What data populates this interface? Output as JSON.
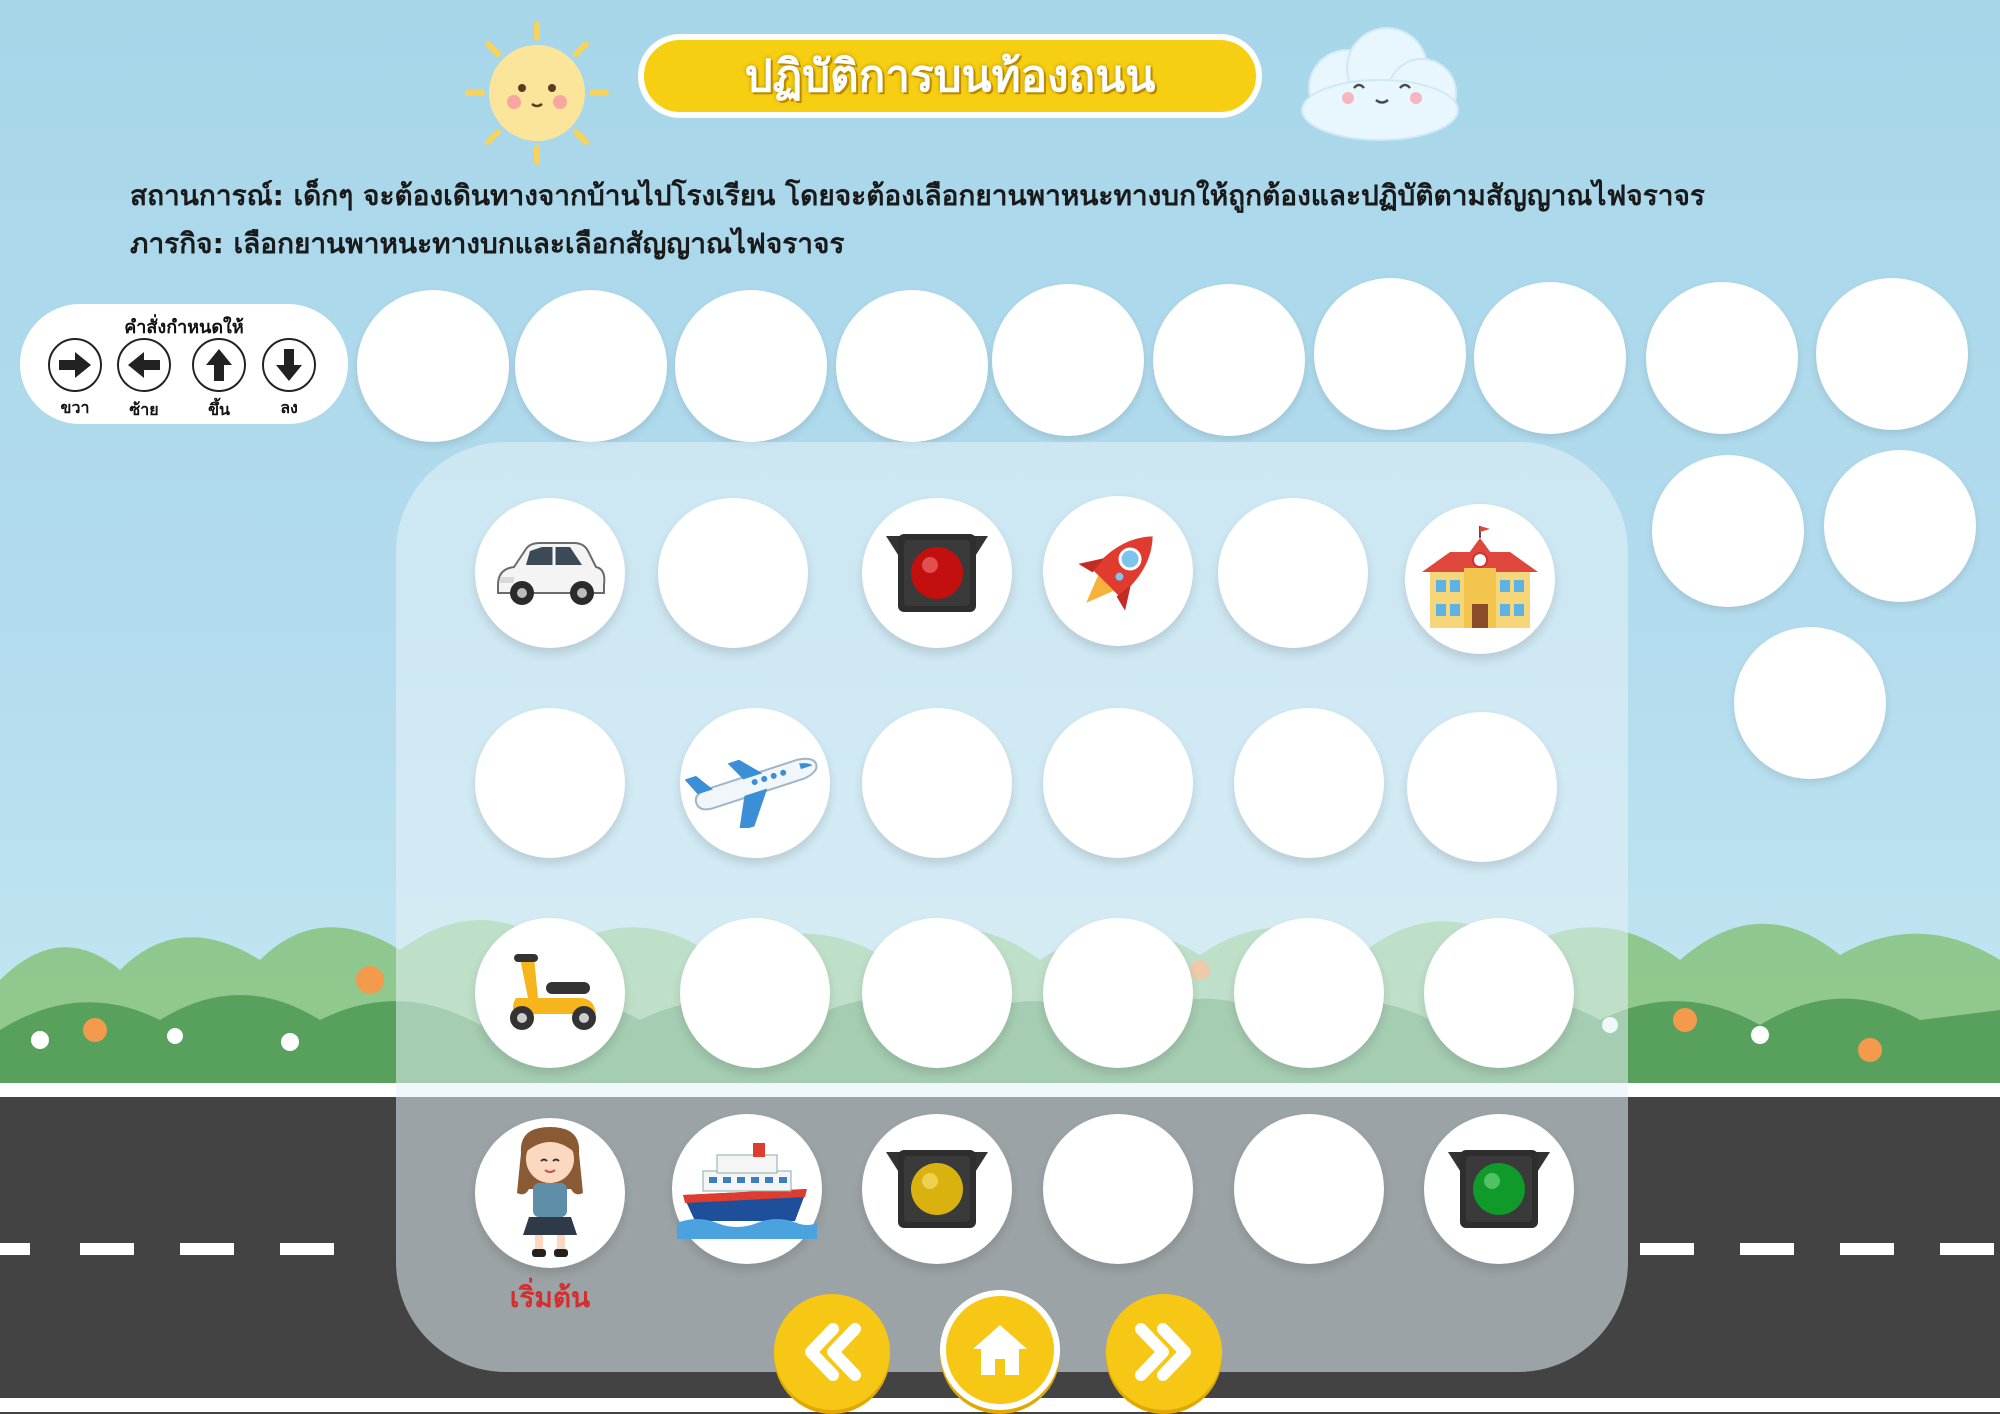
{
  "title": "ปฏิบัติการบนท้องถนน",
  "scenario": "สถานการณ์: เด็กๆ จะต้องเดินทางจากบ้านไปโรงเรียน โดยจะต้องเลือกยานพาหนะทางบกให้ถูกต้องและปฏิบัติตามสัญญาณไฟจราจร",
  "mission": "ภารกิจ: เลือกยานพาหนะทางบกและเลือกสัญญาณไฟจราจร",
  "commands": {
    "title": "คำสั่งกำหนดให้",
    "items": [
      {
        "label": "ขวา",
        "icon": "arrow-right-icon"
      },
      {
        "label": "ซ้าย",
        "icon": "arrow-left-icon"
      },
      {
        "label": "ขึ้น",
        "icon": "arrow-up-icon"
      },
      {
        "label": "ลง",
        "icon": "arrow-down-icon"
      }
    ]
  },
  "grid": [
    [
      "car",
      "",
      "red-light",
      "rocket",
      "",
      "school"
    ],
    [
      "",
      "airplane",
      "",
      "",
      "",
      ""
    ],
    [
      "scooter",
      "",
      "",
      "",
      "",
      ""
    ],
    [
      "girl",
      "ship",
      "yellow-light",
      "",
      "",
      "green-light"
    ]
  ],
  "start_label": "เริ่มต้น",
  "nav": {
    "prev": "double-chevron-left-icon",
    "home": "home-icon",
    "next": "double-chevron-right-icon"
  },
  "colors": {
    "title_bg": "#f7cf12",
    "start_label": "#d42e2e",
    "road": "#434343",
    "sky": "#a7d6e9"
  }
}
